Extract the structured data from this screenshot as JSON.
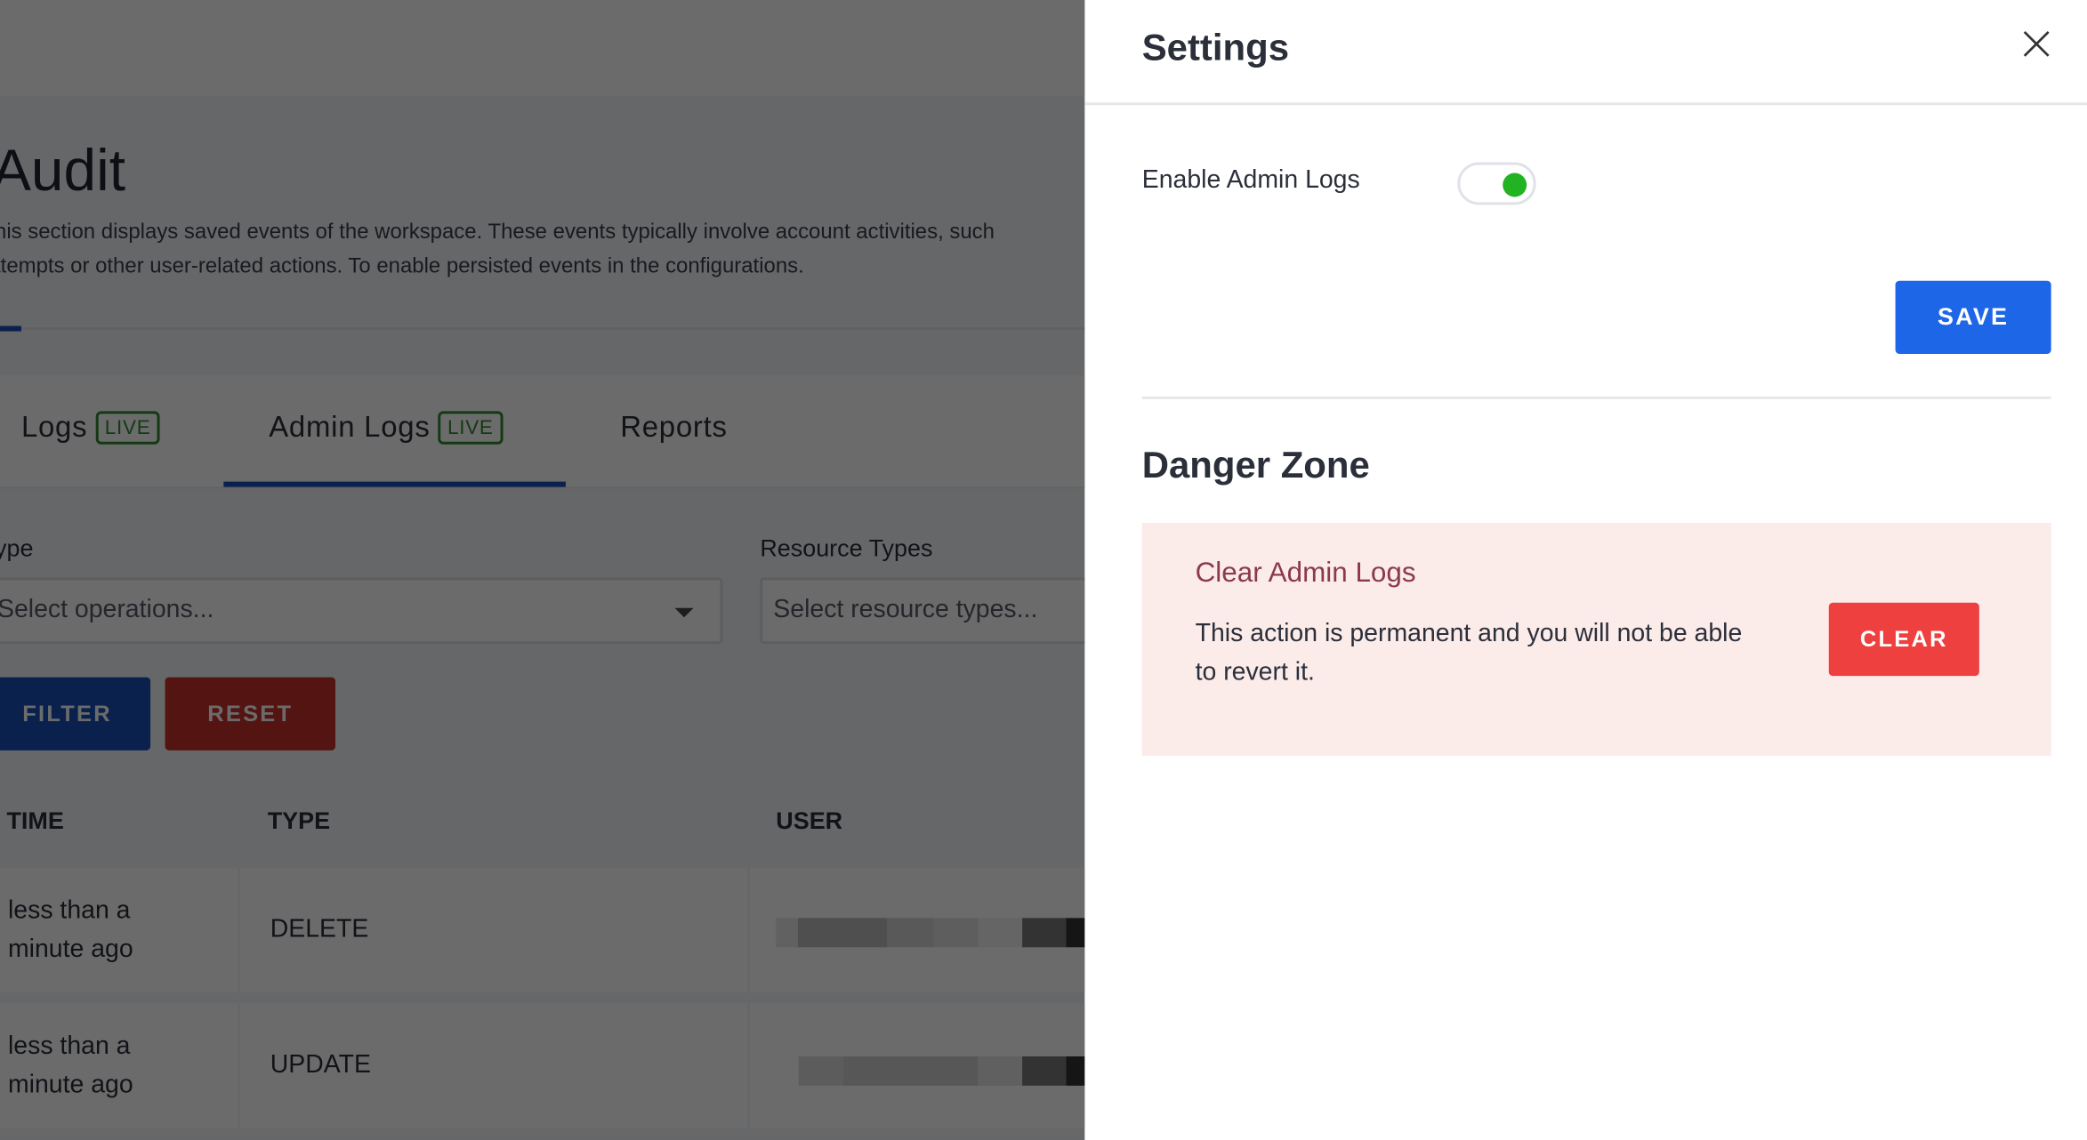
{
  "page": {
    "title": "Audit",
    "description_line1": "his section displays saved events of the workspace. These events typically involve account activities, such",
    "description_line2": "ttempts or other user-related actions. To enable persisted events in the configurations.",
    "tabs": [
      {
        "label": "Logs",
        "badge": "LIVE"
      },
      {
        "label": "Admin Logs",
        "badge": "LIVE",
        "active": true
      },
      {
        "label": "Reports"
      }
    ],
    "filters": {
      "type_label": "ype",
      "type_placeholder": "Select operations...",
      "resource_label": "Resource Types",
      "resource_placeholder": "Select resource types..."
    },
    "filter_button": "FILTER",
    "reset_button": "RESET",
    "table": {
      "columns": [
        "TIME",
        "TYPE",
        "USER"
      ],
      "rows": [
        {
          "time": "less than a minute ago",
          "type": "DELETE"
        },
        {
          "time": "less than a minute ago",
          "type": "UPDATE"
        }
      ]
    }
  },
  "settings": {
    "title": "Settings",
    "close_icon": "close-icon",
    "enable_admin_logs_label": "Enable Admin Logs",
    "enable_admin_logs": true,
    "save_button": "SAVE",
    "danger_zone_title": "Danger Zone",
    "clear_title": "Clear Admin Logs",
    "clear_description": "This action is permanent and you will not be able to revert it.",
    "clear_button": "CLEAR"
  },
  "colors": {
    "primary": "#1d66e8",
    "danger": "#ef4040",
    "toggle_on": "#22b322",
    "danger_bg": "#fbebe9"
  }
}
